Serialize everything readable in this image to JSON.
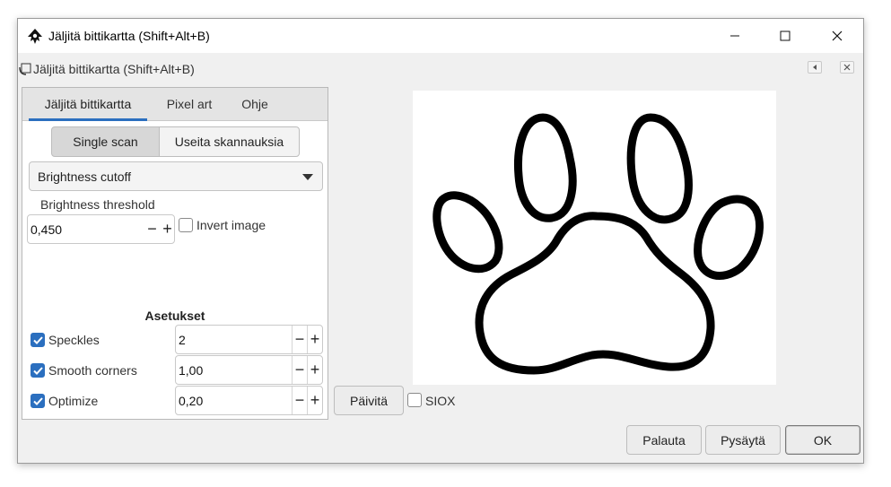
{
  "window": {
    "title": "Jäljitä bittikartta (Shift+Alt+B)",
    "subtitle": "Jäljitä bittikartta (Shift+Alt+B)"
  },
  "tabs": [
    {
      "label": "Jäljitä bittikartta",
      "active": true
    },
    {
      "label": "Pixel art",
      "active": false
    },
    {
      "label": "Ohje",
      "active": false
    }
  ],
  "scan_modes": {
    "single": "Single scan",
    "multiple": "Useita skannauksia",
    "selected": "single"
  },
  "mode_dropdown": {
    "value": "Brightness cutoff"
  },
  "brightness": {
    "label": "Brightness threshold",
    "value": "0,450",
    "invert_label": "Invert image",
    "invert_checked": false
  },
  "settings": {
    "heading": "Asetukset",
    "rows": [
      {
        "label": "Speckles",
        "checked": true,
        "value": "2"
      },
      {
        "label": "Smooth corners",
        "checked": true,
        "value": "1,00"
      },
      {
        "label": "Optimize",
        "checked": true,
        "value": "0,20"
      }
    ]
  },
  "preview": {
    "update_button": "Päivitä",
    "siox_label": "SIOX",
    "siox_checked": false
  },
  "actions": {
    "reset": "Palauta",
    "stop": "Pysäytä",
    "ok": "OK"
  },
  "colors": {
    "accent": "#2b6fbf",
    "window_bg": "#f0f0f0"
  },
  "icons": {
    "app": "inkscape-logo-icon",
    "subtitle": "trace-bitmap-icon",
    "minimize": "minimize-icon",
    "maximize": "maximize-icon",
    "close": "close-icon"
  }
}
